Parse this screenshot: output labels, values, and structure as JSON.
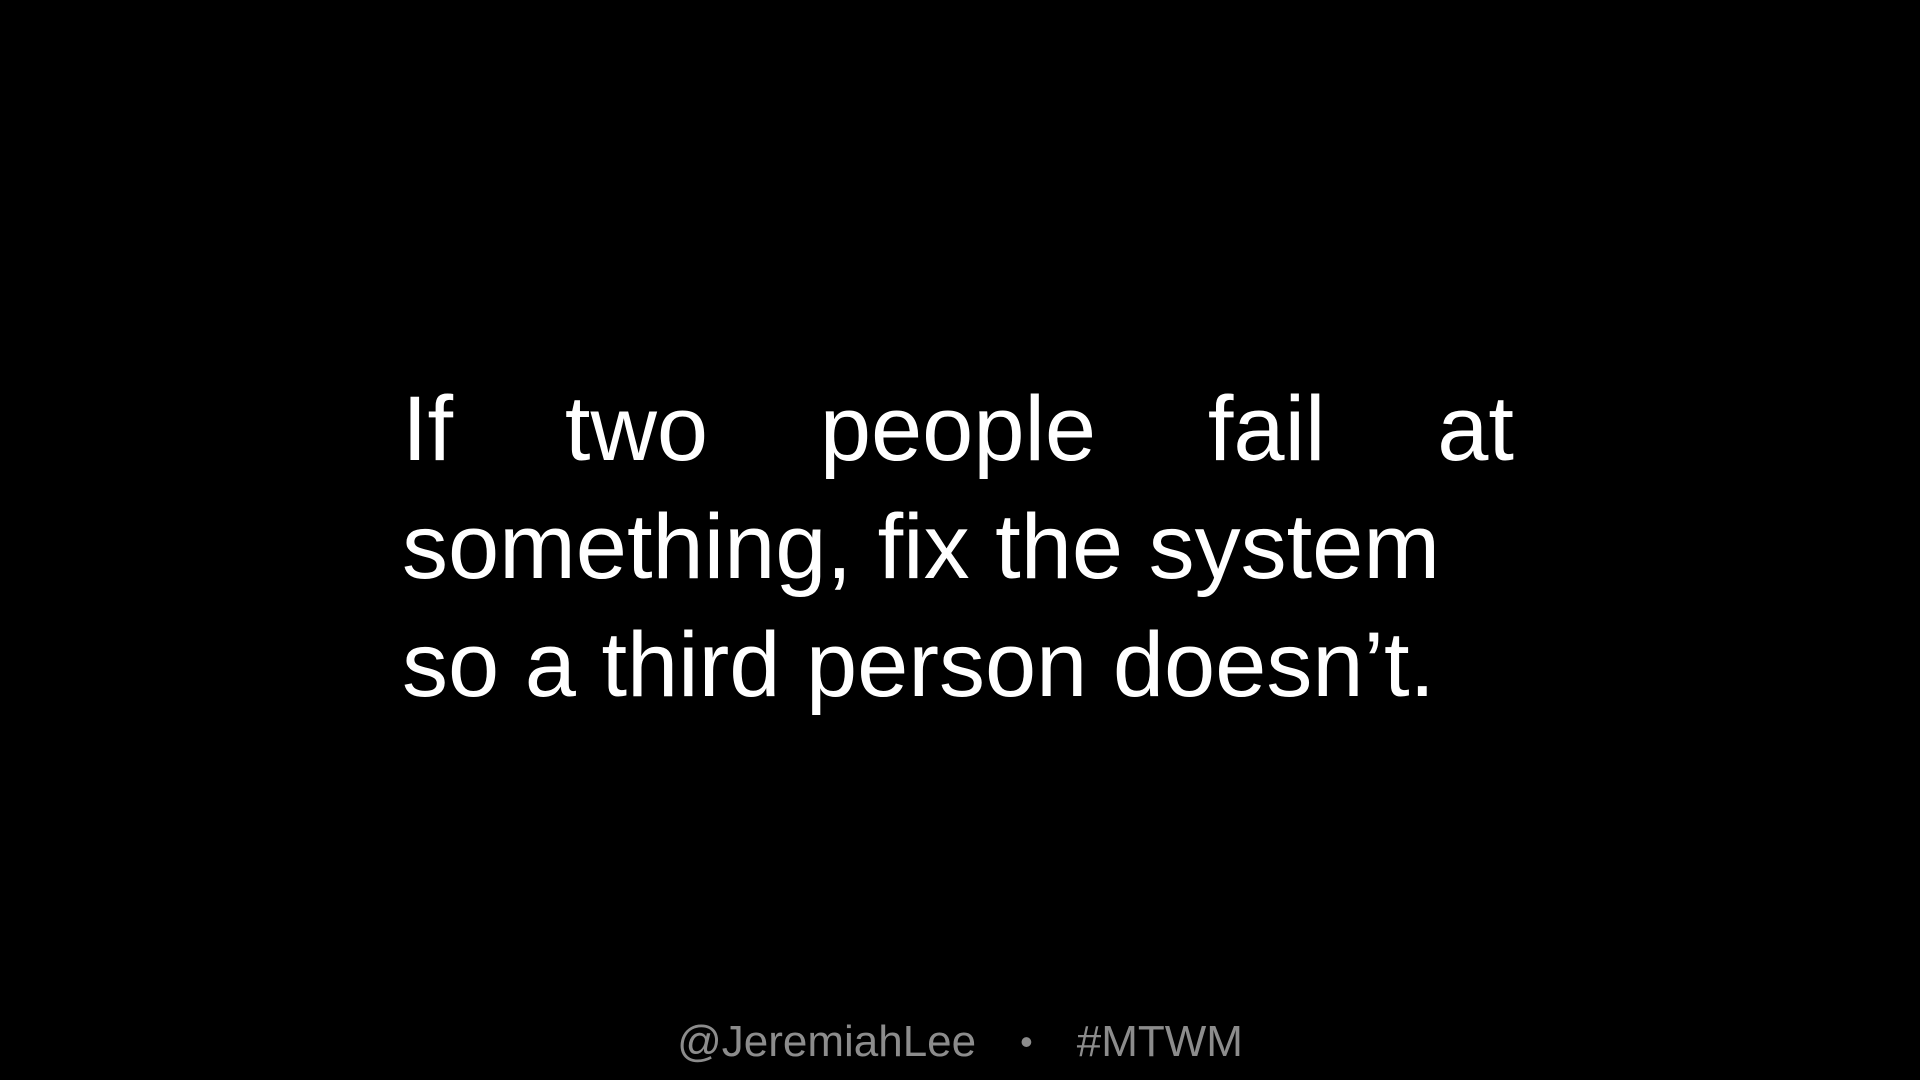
{
  "slide": {
    "quote": {
      "line1_words": [
        "If",
        "two",
        "people",
        "fail",
        "at"
      ],
      "line2": "something, fix the system",
      "line3": "so a third person doesn’t."
    },
    "footer": {
      "handle": "@JeremiahLee",
      "separator": "•",
      "hashtag": "#MTWM"
    }
  },
  "colors": {
    "background": "#000000",
    "quote_text": "#ffffff",
    "footer_text": "#8c8c8c"
  }
}
